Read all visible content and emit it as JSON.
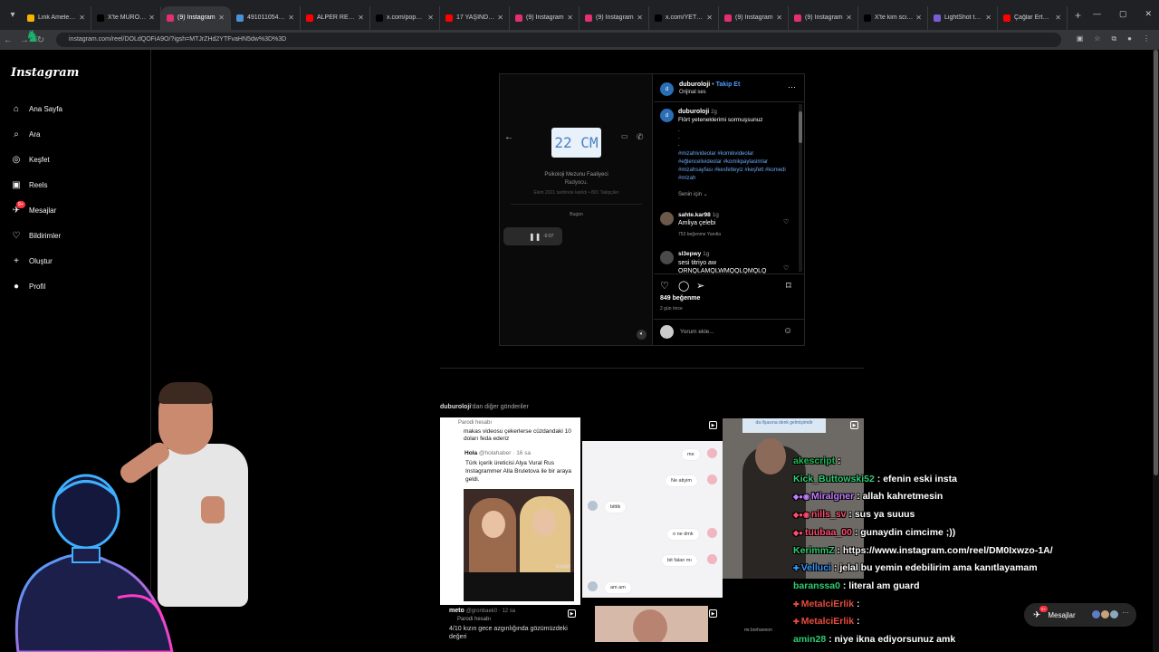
{
  "browser": {
    "tabs": [
      {
        "title": "Link Amelesi v...",
        "color": "#f4b400",
        "active": false
      },
      {
        "title": "X'te MURO: \"D...",
        "color": "#000000",
        "active": false
      },
      {
        "title": "(9) Instagram",
        "color": "#e1306c",
        "active": true
      },
      {
        "title": "491011054-49...",
        "color": "#4a90d9",
        "active": false
      },
      {
        "title": "ALPER RENDE...",
        "color": "#ff0000",
        "active": false
      },
      {
        "title": "x.com/populic...",
        "color": "#000000",
        "active": false
      },
      {
        "title": "17 YAŞINDAKİ...",
        "color": "#ff0000",
        "active": false
      },
      {
        "title": "(9) Instagram",
        "color": "#e1306c",
        "active": false
      },
      {
        "title": "(9) Instagram",
        "color": "#e1306c",
        "active": false
      },
      {
        "title": "x.com/YETOAH...",
        "color": "#000000",
        "active": false
      },
      {
        "title": "(9) Instagram",
        "color": "#e1306c",
        "active": false
      },
      {
        "title": "(9) Instagram",
        "color": "#e1306c",
        "active": false
      },
      {
        "title": "X'te kim scissor...",
        "color": "#000000",
        "active": false
      },
      {
        "title": "LightShot tarafı...",
        "color": "#7b5cd6",
        "active": false
      },
      {
        "title": "Çağlar Ertuğrul...",
        "color": "#ff0000",
        "active": false
      }
    ],
    "url": "instagram.com/reel/DOLdQOFiA9O/?igsh=MTJrZHd2YTFvaHN5dw%3D%3D"
  },
  "sidebar": {
    "logo": "Instagram",
    "items": [
      {
        "label": "Ana Sayfa",
        "icon": "home-icon"
      },
      {
        "label": "Ara",
        "icon": "search-icon"
      },
      {
        "label": "Keşfet",
        "icon": "compass-icon"
      },
      {
        "label": "Reels",
        "icon": "reels-icon"
      },
      {
        "label": "Mesajlar",
        "icon": "messenger-icon",
        "badge": "9+"
      },
      {
        "label": "Bildirimler",
        "icon": "heart-icon"
      },
      {
        "label": "Oluştur",
        "icon": "plus-icon"
      },
      {
        "label": "Profil",
        "icon": "profile-icon"
      }
    ]
  },
  "post": {
    "media": {
      "sticker": "22 CM",
      "profile_name": "Psikoloji Mezunu Faaliyeci",
      "profile_sub": "Radyocu.",
      "profile_date": "Ekim 2021 tarihinde katıldı • 801 Takipçiler",
      "today": "Bugün",
      "voice_duration": "-0:07"
    },
    "author": "duburoloji",
    "follow": "Takip Et",
    "audio": "Orijinal ses",
    "caption_user": "duburoloji",
    "caption_ago": "2g",
    "caption_text": "Flört yeteneklerimi sormuşsunuz",
    "caption_dots": ".\n.\n.",
    "hashtags": "#mizahivideolar #komikvideolar #eğlencelivideolar #komikpaylasimlar #mizahsayfası #kesfetteyiz #keşfett #komedi #mizah",
    "for_you": "Senin için",
    "comments": [
      {
        "user": "sahte.kar98",
        "ago": "1g",
        "text": "Amliya çelebi",
        "meta": "753 beğenme   Yanıtla"
      },
      {
        "user": "sl3epwy",
        "ago": "1g",
        "text": "sesi titriyo aw ORNQLAMQLWMQQLQMQLQ",
        "meta": ""
      }
    ],
    "likes": "849 beğenme",
    "date": "2 gün önce",
    "add_comment": "Yorum ekle..."
  },
  "more": {
    "title_user": "duburoloji",
    "title_rest": "'dan diğer gönderiler",
    "thumb1": {
      "parody": "Parodi hesabı",
      "text": "makas videosu çekerlerse cüzdandaki 10 doları feda ederiz",
      "quote_name": "Hola",
      "quote_handle": "@holahaber · 16 sa",
      "quote_text": "Türk içerik üreticisi Alya Vural Rus Instagrammer Alla Bruletova ile bir araya geldi.",
      "watermark": "English"
    },
    "thumb2": {
      "messages": [
        "me",
        "Ne atiyim",
        "bittik",
        "o ne dmk",
        "bit falan mı",
        "am am"
      ]
    },
    "thumb3": {
      "caption": "da ifşasına denk gelmişimdir"
    },
    "row2_user": "meto",
    "row2_handle": "@gronbaek0 · 12 sa",
    "row2_parody": "Parodi hesabı",
    "row2_text": "4/10 kızın gece azgınlığında gözümüzdeki değeri",
    "row2_right": "mr.borhannon"
  },
  "chat": [
    {
      "user": "akescript",
      "color": "#1db954",
      "text": ":",
      "badges": ""
    },
    {
      "user": "Kick_Buttowski52",
      "color": "#2ecc71",
      "text": ": efenin eski insta",
      "badges": ""
    },
    {
      "user": "Miralgner",
      "color": "#c07bff",
      "text": ": allah kahretmesin",
      "badges": "◆●◉"
    },
    {
      "user": "nills_sv",
      "color": "#ff4b6e",
      "text": ": sus ya suuus",
      "badges": "◆●◉"
    },
    {
      "user": "tuubaa_00",
      "color": "#ff4b6e",
      "text": ": gunaydin cimcime ;))",
      "badges": "◆●"
    },
    {
      "user": "KerimmZ",
      "color": "#2ecc71",
      "text": ": https://www.instagram.com/reel/DM0Ixwzo-1A/",
      "badges": ""
    },
    {
      "user": "Velluci",
      "color": "#3498ff",
      "text": ": jelal bu yemin edebilirim ama kanıtlayamam",
      "badges": "✚"
    },
    {
      "user": "baranssa0",
      "color": "#2ecc71",
      "text": ": literal am guard",
      "badges": ""
    },
    {
      "user": "MetalciErlik",
      "color": "#e74c3c",
      "text": ":",
      "badges": "✚"
    },
    {
      "user": "MetalciErlik",
      "color": "#e74c3c",
      "text": ":",
      "badges": "✚"
    },
    {
      "user": "amin28",
      "color": "#2ecc71",
      "text": ": niye ikna ediyorsunuz amk",
      "badges": ""
    }
  ],
  "messages_pill": {
    "label": "Mesajlar",
    "badge": "9+"
  }
}
